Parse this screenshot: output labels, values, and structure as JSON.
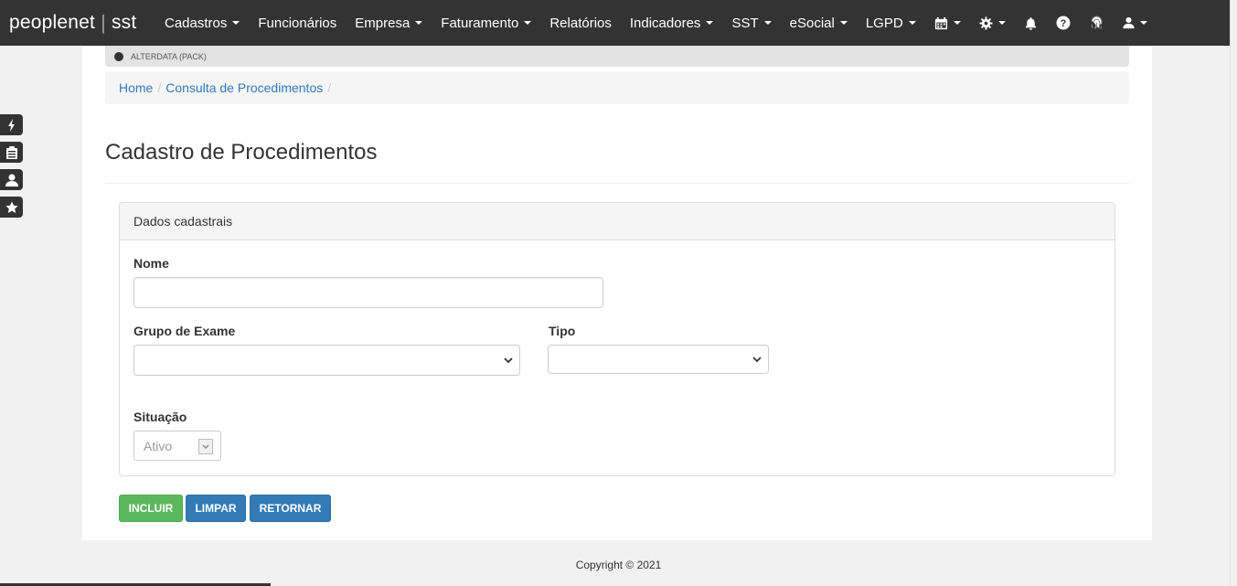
{
  "brand": {
    "name": "peoplenet",
    "suffix": "sst"
  },
  "nav": {
    "items": [
      {
        "label": "Cadastros",
        "dropdown": true
      },
      {
        "label": "Funcionários",
        "dropdown": false
      },
      {
        "label": "Empresa",
        "dropdown": true
      },
      {
        "label": "Faturamento",
        "dropdown": true
      },
      {
        "label": "Relatórios",
        "dropdown": false
      },
      {
        "label": "Indicadores",
        "dropdown": true
      },
      {
        "label": "SST",
        "dropdown": true
      },
      {
        "label": "eSocial",
        "dropdown": true
      },
      {
        "label": "LGPD",
        "dropdown": true
      }
    ],
    "icons": [
      "calendar-icon",
      "gear-icon",
      "bell-icon",
      "question-circle-icon",
      "fingerprint-icon",
      "user-icon"
    ]
  },
  "notice": {
    "text": "ALTERDATA (PACK)"
  },
  "breadcrumb": {
    "home": "Home",
    "current": "Consulta de Procedimentos"
  },
  "page": {
    "title": "Cadastro de Procedimentos"
  },
  "panel": {
    "heading": "Dados cadastrais"
  },
  "form": {
    "nome_label": "Nome",
    "nome_value": "",
    "grupo_label": "Grupo de Exame",
    "grupo_value": "",
    "tipo_label": "Tipo",
    "tipo_value": "",
    "situacao_label": "Situação",
    "situacao_value": "Ativo"
  },
  "buttons": {
    "incluir": "INCLUIR",
    "limpar": "LIMPAR",
    "retornar": "RETORNAR"
  },
  "footer": {
    "copyright": "Copyright © 2021"
  },
  "colors": {
    "navbar": "#333333",
    "link": "#337ab7",
    "success": "#5cb85c",
    "primary": "#337ab7"
  }
}
